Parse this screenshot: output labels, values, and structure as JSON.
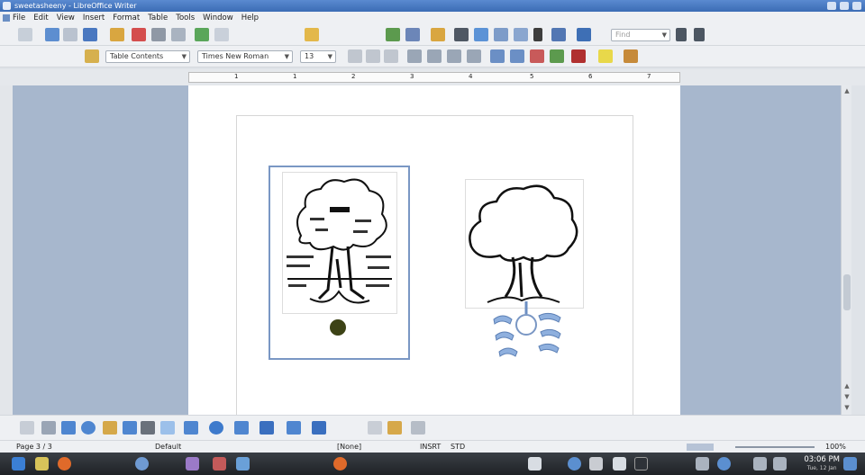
{
  "window": {
    "title": "sweetasheeny - LibreOffice Writer"
  },
  "menu": [
    "File",
    "Edit",
    "View",
    "Insert",
    "Format",
    "Table",
    "Tools",
    "Window",
    "Help"
  ],
  "toolbar": {
    "find_placeholder": "Find",
    "paragraph_style": "Table Contents",
    "font_name": "Times New Roman",
    "font_size": "13"
  },
  "ruler": {
    "numbers": [
      "1",
      "1",
      "2",
      "3",
      "4",
      "5",
      "6",
      "7"
    ]
  },
  "status": {
    "page": "Page 3 / 3",
    "style": "Default",
    "language": "[None]",
    "mode": "INSRT",
    "selection": "STD",
    "zoom": "100%"
  },
  "taskbar": {
    "time": "03:06 PM",
    "date": "Tue, 12 Jan"
  },
  "colors": {
    "accent": "#3b6cb5",
    "doc_bg": "#a7b7cd",
    "frame": "#7a97c4"
  }
}
